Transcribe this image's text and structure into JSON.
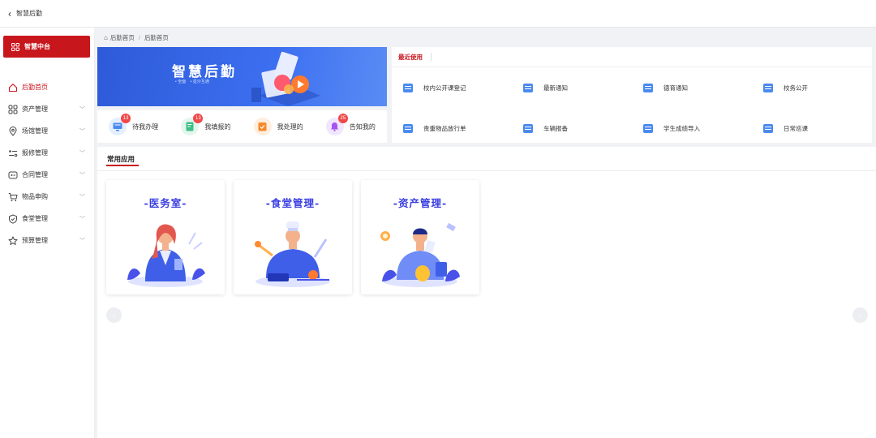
{
  "topbar": {
    "back_icon": "chevron-left-icon",
    "title": "智慧后勤"
  },
  "sidebar": {
    "brand_label": "智慧中台",
    "items": [
      {
        "label": "后勤首页",
        "icon": "home-icon",
        "active": true,
        "expandable": false
      },
      {
        "label": "资产管理",
        "icon": "grid-icon",
        "active": false,
        "expandable": true
      },
      {
        "label": "场馆管理",
        "icon": "location-icon",
        "active": false,
        "expandable": true
      },
      {
        "label": "报修管理",
        "icon": "repair-icon",
        "active": false,
        "expandable": true
      },
      {
        "label": "合同管理",
        "icon": "contract-icon",
        "active": false,
        "expandable": true
      },
      {
        "label": "物品申购",
        "icon": "cart-icon",
        "active": false,
        "expandable": true
      },
      {
        "label": "食堂管理",
        "icon": "shield-check-icon",
        "active": false,
        "expandable": true
      },
      {
        "label": "预算管理",
        "icon": "star-icon",
        "active": false,
        "expandable": true
      }
    ]
  },
  "breadcrumb": {
    "home": "后勤首页",
    "current": "后勤首页"
  },
  "banner": {
    "title": "智慧后勤",
    "sub1": "• 全面",
    "sub2": "• 星沙互通"
  },
  "quick_actions": [
    {
      "label": "待我办理",
      "count": "13",
      "bg": "#e4efff",
      "fg": "#4a8af0",
      "icon": "monitor-icon"
    },
    {
      "label": "我填报的",
      "count": "13",
      "bg": "#e3f6ee",
      "fg": "#3dbf86",
      "icon": "edit-doc-icon"
    },
    {
      "label": "我处理的",
      "count": "",
      "bg": "#ffeede",
      "fg": "#f58a2b",
      "icon": "clipboard-check-icon"
    },
    {
      "label": "告知我的",
      "count": "25",
      "bg": "#f1e6ff",
      "fg": "#a651f0",
      "icon": "bell-icon"
    }
  ],
  "recent": {
    "title": "最近使用",
    "items": [
      {
        "label": "校内公开课登记"
      },
      {
        "label": "最新通知"
      },
      {
        "label": "德育通知"
      },
      {
        "label": "校务公开"
      },
      {
        "label": "贵重物品放行单"
      },
      {
        "label": "车辆报备"
      },
      {
        "label": "学生成绩导入"
      },
      {
        "label": "日常巡课"
      }
    ]
  },
  "apps": {
    "title": "常用应用",
    "cards": [
      {
        "label": "-医务室-",
        "icon": "doctor-illustration-icon"
      },
      {
        "label": "-食堂管理-",
        "icon": "chef-illustration-icon"
      },
      {
        "label": "-资产管理-",
        "icon": "asset-illustration-icon"
      }
    ]
  },
  "colors": {
    "accent": "#c8161d",
    "banner": "#3c6ff0",
    "card_title": "#3a3ee0"
  }
}
